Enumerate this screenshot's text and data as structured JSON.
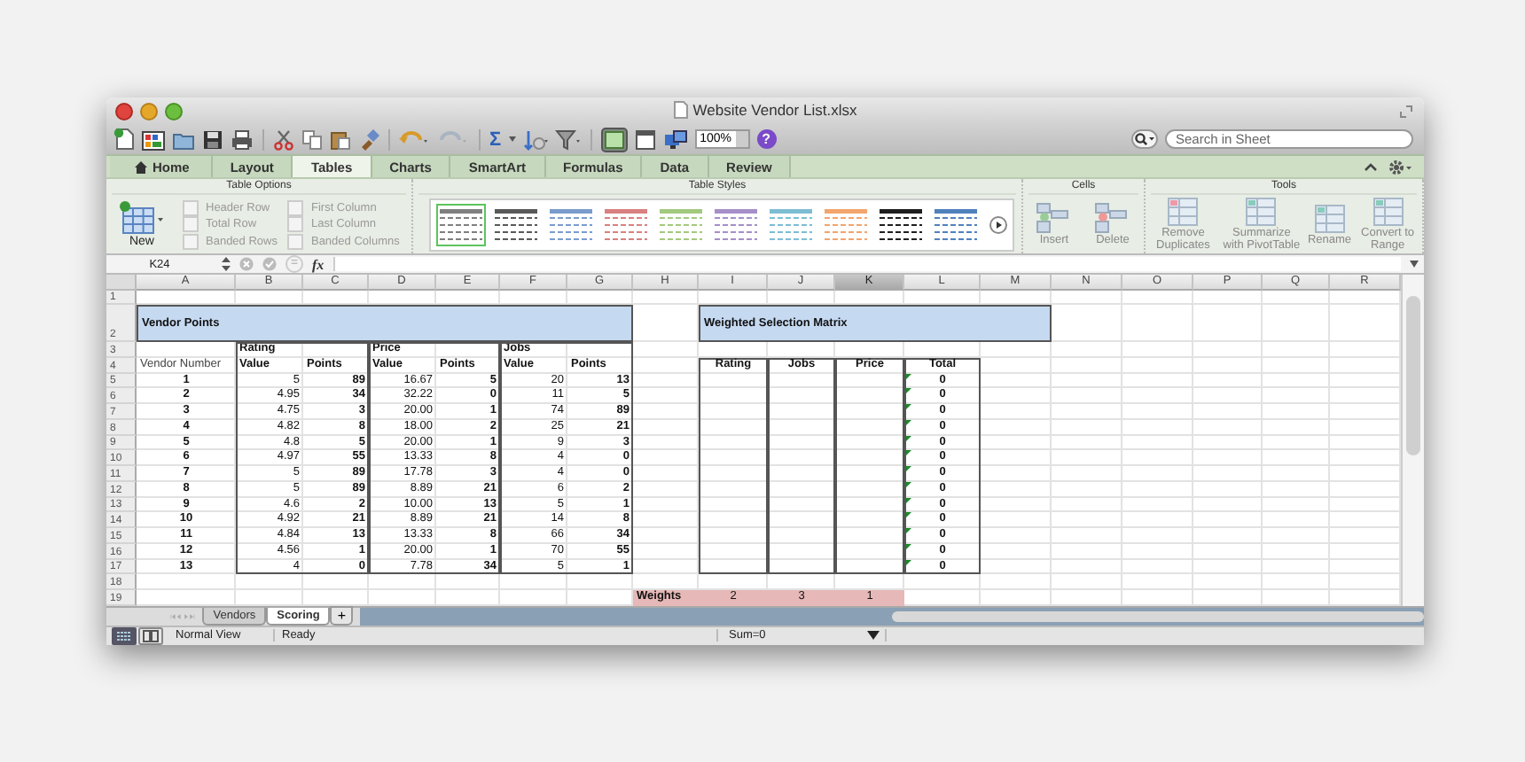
{
  "window": {
    "title": "Website Vendor List.xlsx"
  },
  "toolbar": {
    "sum_symbol": "Σ",
    "zoom": "100%",
    "help": "?",
    "search": {
      "placeholder": "Search in Sheet"
    }
  },
  "ribbon": {
    "tabs": [
      {
        "label": "Home",
        "selected": false
      },
      {
        "label": "Layout",
        "selected": false
      },
      {
        "label": "Tables",
        "selected": true
      },
      {
        "label": "Charts",
        "selected": false
      },
      {
        "label": "SmartArt",
        "selected": false
      },
      {
        "label": "Formulas",
        "selected": false
      },
      {
        "label": "Data",
        "selected": false
      },
      {
        "label": "Review",
        "selected": false
      }
    ],
    "table_options": {
      "title": "Table Options",
      "new_button": "New",
      "checkboxes": [
        {
          "label": "Header Row",
          "checked": false,
          "disabled": true
        },
        {
          "label": "Total Row",
          "checked": false,
          "disabled": true
        },
        {
          "label": "Banded Rows",
          "checked": false,
          "disabled": true
        },
        {
          "label": "First Column",
          "checked": false,
          "disabled": true
        },
        {
          "label": "Last Column",
          "checked": false,
          "disabled": true
        },
        {
          "label": "Banded Columns",
          "checked": false,
          "disabled": true
        }
      ]
    },
    "table_styles": {
      "title": "Table Styles",
      "styles": [
        {
          "color": "#7f7f7f",
          "selected": true
        },
        {
          "color": "#595959",
          "selected": false
        },
        {
          "color": "#7a9ccc",
          "selected": false
        },
        {
          "color": "#d98080",
          "selected": false
        },
        {
          "color": "#a3c97f",
          "selected": false
        },
        {
          "color": "#a58fc9",
          "selected": false
        },
        {
          "color": "#7cbdd3",
          "selected": false
        },
        {
          "color": "#f2a56e",
          "selected": false
        },
        {
          "color": "#1f1f1f",
          "selected": false
        },
        {
          "color": "#4f81bd",
          "selected": false
        }
      ]
    },
    "cells": {
      "title": "Cells",
      "buttons": [
        {
          "label": "Insert",
          "disabled": true
        },
        {
          "label": "Delete",
          "disabled": true
        }
      ]
    },
    "tools": {
      "title": "Tools",
      "buttons": [
        {
          "label": "Remove Duplicates",
          "disabled": true
        },
        {
          "label": "Summarize with PivotTable",
          "disabled": true
        },
        {
          "label": "Rename",
          "disabled": true
        },
        {
          "label": "Convert to Range",
          "disabled": true
        }
      ]
    }
  },
  "formula_bar": {
    "name_box": "K24",
    "equals_symbol": "=",
    "fx": "fx"
  },
  "sheet": {
    "columns": [
      {
        "label": "A",
        "selected": false
      },
      {
        "label": "B",
        "selected": false
      },
      {
        "label": "C",
        "selected": false
      },
      {
        "label": "D",
        "selected": false
      },
      {
        "label": "E",
        "selected": false
      },
      {
        "label": "F",
        "selected": false
      },
      {
        "label": "G",
        "selected": false
      },
      {
        "label": "H",
        "selected": false
      },
      {
        "label": "I",
        "selected": false
      },
      {
        "label": "J",
        "selected": false
      },
      {
        "label": "K",
        "selected": true
      },
      {
        "label": "L",
        "selected": false
      },
      {
        "label": "M",
        "selected": false
      },
      {
        "label": "N",
        "selected": false
      },
      {
        "label": "O",
        "selected": false
      },
      {
        "label": "P",
        "selected": false
      },
      {
        "label": "Q",
        "selected": false
      },
      {
        "label": "R",
        "selected": false
      }
    ],
    "rows": [
      "1",
      "2",
      "3",
      "4",
      "5",
      "6",
      "7",
      "8",
      "9",
      "10",
      "11",
      "12",
      "13",
      "14",
      "15",
      "16",
      "17",
      "18",
      "19"
    ],
    "vendor_points": {
      "title": "Vendor Points",
      "groups": [
        "Rating",
        "Price",
        "Jobs"
      ],
      "headers": [
        "Vendor Number",
        "Value",
        "Points",
        "Value",
        "Points",
        "Value",
        "Points"
      ],
      "rows": [
        [
          "1",
          "5",
          "89",
          "16.67",
          "5",
          "20",
          "13"
        ],
        [
          "2",
          "4.95",
          "34",
          "32.22",
          "0",
          "11",
          "5"
        ],
        [
          "3",
          "4.75",
          "3",
          "20.00",
          "1",
          "74",
          "89"
        ],
        [
          "4",
          "4.82",
          "8",
          "18.00",
          "2",
          "25",
          "21"
        ],
        [
          "5",
          "4.8",
          "5",
          "20.00",
          "1",
          "9",
          "3"
        ],
        [
          "6",
          "4.97",
          "55",
          "13.33",
          "8",
          "4",
          "0"
        ],
        [
          "7",
          "5",
          "89",
          "17.78",
          "3",
          "4",
          "0"
        ],
        [
          "8",
          "5",
          "89",
          "8.89",
          "21",
          "6",
          "2"
        ],
        [
          "9",
          "4.6",
          "2",
          "10.00",
          "13",
          "5",
          "1"
        ],
        [
          "10",
          "4.92",
          "21",
          "8.89",
          "21",
          "14",
          "8"
        ],
        [
          "11",
          "4.84",
          "13",
          "13.33",
          "8",
          "66",
          "34"
        ],
        [
          "12",
          "4.56",
          "1",
          "20.00",
          "1",
          "70",
          "55"
        ],
        [
          "13",
          "4",
          "0",
          "7.78",
          "34",
          "5",
          "1"
        ]
      ]
    },
    "weighted_matrix": {
      "title": "Weighted Selection Matrix",
      "headers": [
        "Rating",
        "Jobs",
        "Price",
        "Total"
      ],
      "totals": [
        "0",
        "0",
        "0",
        "0",
        "0",
        "0",
        "0",
        "0",
        "0",
        "0",
        "0",
        "0",
        "0"
      ]
    },
    "weights": {
      "label": "Weights",
      "values": [
        "2",
        "3",
        "1"
      ]
    }
  },
  "sheet_tabs": [
    {
      "label": "Vendors",
      "selected": false
    },
    {
      "label": "Scoring",
      "selected": true
    }
  ],
  "add_sheet": "+",
  "status_bar": {
    "view": "Normal View",
    "status": "Ready",
    "sum": "Sum=0"
  }
}
